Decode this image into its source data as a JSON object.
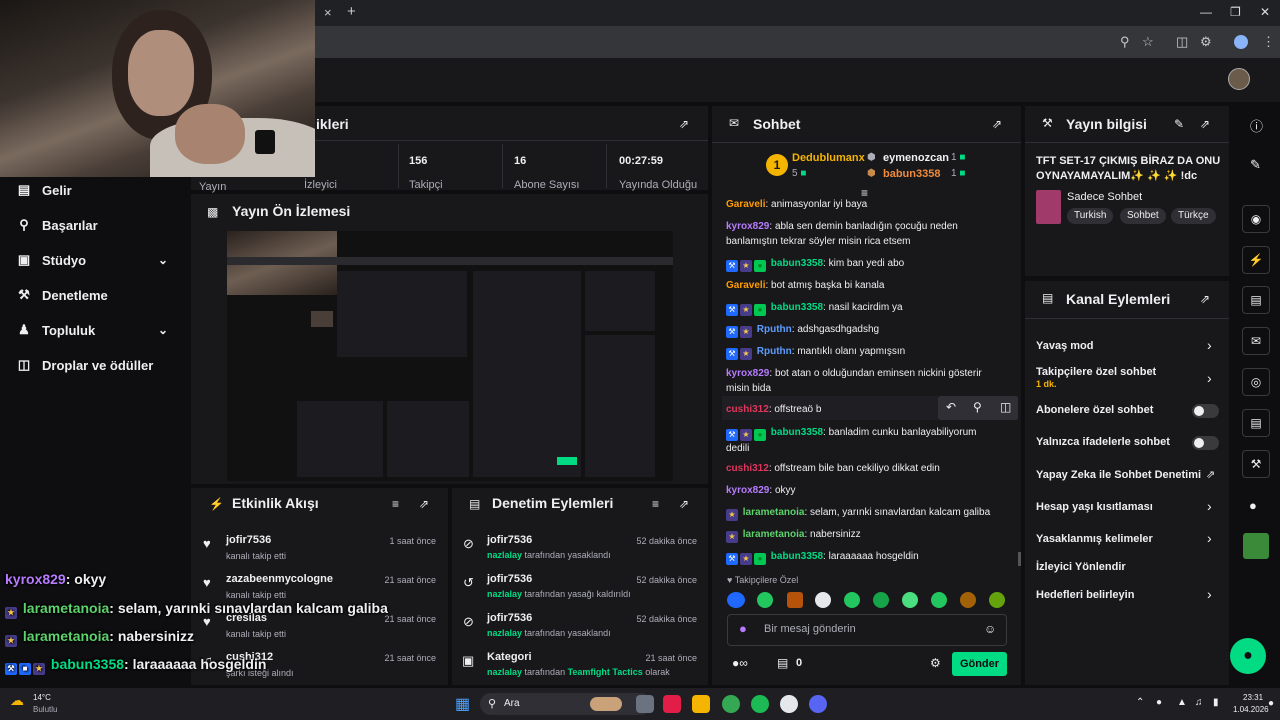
{
  "browser": {
    "new_tab": "+",
    "tab_close": "×"
  },
  "nav": [
    {
      "label": "Gelir",
      "icon": "bar-chart-icon"
    },
    {
      "label": "Başarılar",
      "icon": "trophy-icon"
    },
    {
      "label": "Stüdyo",
      "icon": "video-icon"
    },
    {
      "label": "Denetleme",
      "icon": "wrench-icon"
    },
    {
      "label": "Topluluk",
      "icon": "people-icon"
    },
    {
      "label": "Droplar ve ödüller",
      "icon": "gift-icon"
    }
  ],
  "stats": {
    "title": "ikleri",
    "items": [
      {
        "value": "",
        "label": "Yayın"
      },
      {
        "value": "",
        "label": "İzleyici"
      },
      {
        "value": "156",
        "label": "Takipçi"
      },
      {
        "value": "16",
        "label": "Abone Sayısı"
      },
      {
        "value": "00:27:59",
        "label": "Yayında Olduğu"
      }
    ]
  },
  "preview": {
    "title": "Yayın Ön İzlemesi"
  },
  "activity": {
    "title": "Etkinlik Akışı",
    "items": [
      {
        "user": "jofir7536",
        "sub": "kanalı takip etti",
        "time": "1 saat önce"
      },
      {
        "user": "zazabeenmycologne",
        "sub": "kanalı takip etti",
        "time": "21 saat önce"
      },
      {
        "user": "cresilas",
        "sub": "kanalı takip etti",
        "time": "21 saat önce"
      },
      {
        "user": "cushi312",
        "sub": "şarkı isteği alındı",
        "time": "21 saat önce"
      }
    ]
  },
  "moderation": {
    "title": "Denetim Eylemleri",
    "items": [
      {
        "user": "jofir7536",
        "actor": "nazlalay",
        "action": "tarafından yasaklandı",
        "time": "52 dakika önce"
      },
      {
        "user": "jofir7536",
        "actor": "nazlalay",
        "action": "tarafından yasağı kaldırıldı",
        "time": "52 dakika önce"
      },
      {
        "user": "jofir7536",
        "actor": "nazlalay",
        "action": "tarafından yasaklandı",
        "time": "52 dakika önce"
      },
      {
        "user": "Kategori",
        "actor": "nazlalay",
        "action": "tarafından",
        "extra": "Teamfight Tactics",
        "extra2": "olarak",
        "time": "21 saat önce"
      }
    ]
  },
  "chat": {
    "title": "Sohbet",
    "leaders": {
      "first": {
        "rank": "1",
        "name": "Dedublumanx",
        "count": "5"
      },
      "second": {
        "name": "eymenozcan",
        "count": "1"
      },
      "third": {
        "name": "babun3358",
        "count": "1"
      }
    },
    "messages": [
      {
        "user": "Garaveli",
        "color": "#ff9c00",
        "text": "animasyonlar iyi baya",
        "badges": ""
      },
      {
        "user": "kyrox829",
        "color": "#b77cff",
        "text": "abla sen demin banladığın çocuğu neden banlamıştın tekrar söyler misin rica etsem",
        "badges": ""
      },
      {
        "user": "babun3358",
        "color": "#00db84",
        "text": "kim ban yedi abo",
        "badges": "vip"
      },
      {
        "user": "Garaveli",
        "color": "#ff9c00",
        "text": "bot atmış başka bi kanala",
        "badges": ""
      },
      {
        "user": "babun3358",
        "color": "#00db84",
        "text": "nasil kacirdim ya",
        "badges": "vip"
      },
      {
        "user": "Rputhn",
        "color": "#5c9cff",
        "text": "adshgasdhgadshg",
        "badges": "mod"
      },
      {
        "user": "Rputhn",
        "color": "#5c9cff",
        "text": "mantıklı olanı yapmışsın",
        "badges": "mod"
      },
      {
        "user": "kyrox829",
        "color": "#b77cff",
        "text": "bot atan o olduğundan eminsen nickini gösterir misin bida",
        "badges": ""
      },
      {
        "user": "cushi312",
        "color": "#e0365d",
        "text": "offstreaö b",
        "badges": ""
      },
      {
        "user": "babun3358",
        "color": "#00db84",
        "text": "banladim cunku banlayabiliyorum dedili",
        "badges": "vip"
      },
      {
        "user": "cushi312",
        "color": "#e0365d",
        "text": "offstream bile ban cekiliyo dikkat edin",
        "badges": ""
      },
      {
        "user": "kyrox829",
        "color": "#b77cff",
        "text": "okyy",
        "badges": ""
      },
      {
        "user": "larametanoia",
        "color": "#5cd26b",
        "text": "selam, yarınki sınavlardan kalcam galiba",
        "badges": "star"
      },
      {
        "user": "larametanoia",
        "color": "#5cd26b",
        "text": "nabersinizz",
        "badges": "star"
      },
      {
        "user": "babun3358",
        "color": "#00db84",
        "text": "laraaaaaa hosgeldin",
        "badges": "vip"
      }
    ],
    "followers_only": "Takipçilere Özel",
    "input_placeholder": "Bir mesaj gönderin",
    "points": "0",
    "send": "Gönder"
  },
  "stream_info": {
    "title": "Yayın bilgisi",
    "stream_title": "TFT SET-17 ÇIKMIŞ BİRAZ DA ONU OYNAYAMAYALIM✨ ✨ ✨ !dc",
    "category": "Sadece Sohbet",
    "tags": [
      "Turkish",
      "Sohbet",
      "Türkçe"
    ]
  },
  "channel_actions": {
    "title": "Kanal Eylemleri",
    "items": [
      {
        "label": "Yavaş mod",
        "control": "chevron"
      },
      {
        "label": "Takipçilere özel sohbet",
        "sub": "1 dk.",
        "control": "chevron"
      },
      {
        "label": "Abonelere özel sohbet",
        "control": "toggle"
      },
      {
        "label": "Yalnızca ifadelerle sohbet",
        "control": "toggle"
      },
      {
        "label": "Yapay Zeka ile Sohbet Denetimi",
        "control": "external"
      },
      {
        "label": "Hesap yaşı kısıtlaması",
        "control": "chevron"
      },
      {
        "label": "Yasaklanmış kelimeler",
        "control": "chevron"
      },
      {
        "label": "İzleyici Yönlendir",
        "control": "none"
      },
      {
        "label": "Hedefleri belirleyin",
        "control": "chevron"
      }
    ]
  },
  "overlay_chat": [
    {
      "user": "kyrox829",
      "text": ": okyy",
      "color": "#b77cff"
    },
    {
      "user": "larametanoia",
      "text": ": selam, yarınki sınavlardan kalcam galiba",
      "color": "#5cd26b"
    },
    {
      "user": "larametanoia",
      "text": ": nabersinizz",
      "color": "#5cd26b"
    },
    {
      "user": "babun3358",
      "text": ": laraaaaaa hosgeldin",
      "color": "#00db84"
    }
  ],
  "taskbar": {
    "weather_temp": "14°C",
    "weather_desc": "Bulutlu",
    "search": "Ara",
    "time": "23:31",
    "date": "1.04.2026"
  }
}
